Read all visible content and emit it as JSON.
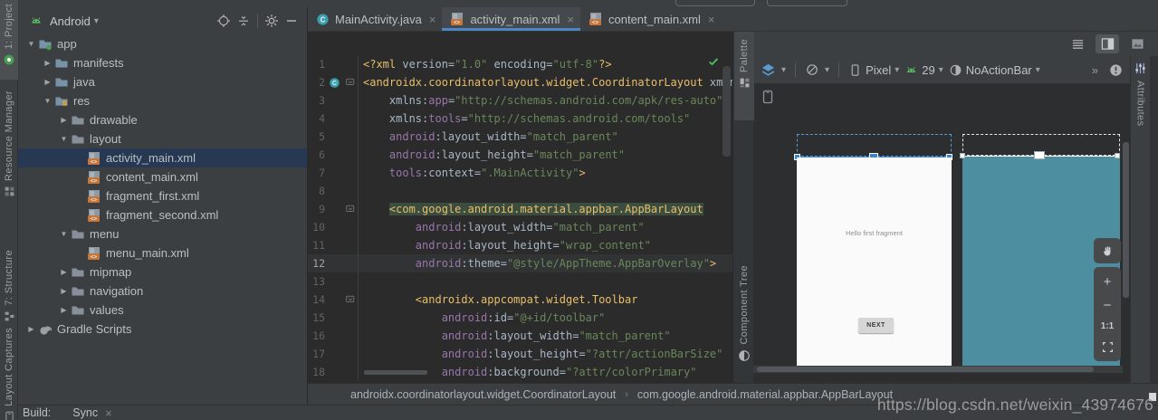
{
  "left_strip": {
    "items": [
      {
        "label": "1: Project"
      },
      {
        "label": "Resource Manager"
      },
      {
        "label": "7: Structure"
      },
      {
        "label": "Layout Captures"
      }
    ]
  },
  "project_panel": {
    "header": {
      "title": "Android"
    },
    "tree": [
      {
        "label": "app",
        "depth": 0,
        "arrow": "expanded",
        "icon": "folder-app"
      },
      {
        "label": "manifests",
        "depth": 1,
        "arrow": "collapsed",
        "icon": "folder"
      },
      {
        "label": "java",
        "depth": 1,
        "arrow": "collapsed",
        "icon": "folder"
      },
      {
        "label": "res",
        "depth": 1,
        "arrow": "expanded",
        "icon": "folder-res"
      },
      {
        "label": "drawable",
        "depth": 2,
        "arrow": "collapsed",
        "icon": "folder2"
      },
      {
        "label": "layout",
        "depth": 2,
        "arrow": "expanded",
        "icon": "folder2"
      },
      {
        "label": "activity_main.xml",
        "depth": 3,
        "arrow": "none",
        "icon": "xml",
        "selected": true
      },
      {
        "label": "content_main.xml",
        "depth": 3,
        "arrow": "none",
        "icon": "xml"
      },
      {
        "label": "fragment_first.xml",
        "depth": 3,
        "arrow": "none",
        "icon": "xml"
      },
      {
        "label": "fragment_second.xml",
        "depth": 3,
        "arrow": "none",
        "icon": "xml"
      },
      {
        "label": "menu",
        "depth": 2,
        "arrow": "expanded",
        "icon": "folder2"
      },
      {
        "label": "menu_main.xml",
        "depth": 3,
        "arrow": "none",
        "icon": "xml"
      },
      {
        "label": "mipmap",
        "depth": 2,
        "arrow": "collapsed",
        "icon": "folder2"
      },
      {
        "label": "navigation",
        "depth": 2,
        "arrow": "collapsed",
        "icon": "folder2"
      },
      {
        "label": "values",
        "depth": 2,
        "arrow": "collapsed",
        "icon": "folder2"
      },
      {
        "label": "Gradle Scripts",
        "depth": 0,
        "arrow": "collapsed",
        "icon": "gradle"
      }
    ]
  },
  "editor_tabs": [
    {
      "label": "MainActivity.java",
      "icon": "class",
      "active": false
    },
    {
      "label": "activity_main.xml",
      "icon": "xml",
      "active": true
    },
    {
      "label": "content_main.xml",
      "icon": "xml",
      "active": false
    }
  ],
  "editor": {
    "lines": [
      {
        "n": 1,
        "t": [
          [
            "tag",
            "<?xml "
          ],
          [
            "p",
            "version="
          ],
          [
            "str",
            "\"1.0\""
          ],
          [
            "p",
            " encoding="
          ],
          [
            "str",
            "\"utf-8\""
          ],
          [
            "tag",
            "?>"
          ]
        ]
      },
      {
        "n": 2,
        "icon": "class-gutter",
        "fold": true,
        "t": [
          [
            "tag",
            "<androidx.coordinatorlayout.widget.CoordinatorLayout"
          ],
          [
            "p",
            " xmlns"
          ]
        ]
      },
      {
        "n": 3,
        "t": [
          [
            "p",
            "    xmlns:"
          ],
          [
            "ns",
            "app"
          ],
          [
            "p",
            "="
          ],
          [
            "str",
            "\"http://schemas.android.com/apk/res-auto\""
          ]
        ]
      },
      {
        "n": 4,
        "t": [
          [
            "p",
            "    xmlns:"
          ],
          [
            "ns",
            "tools"
          ],
          [
            "p",
            "="
          ],
          [
            "str",
            "\"http://schemas.android.com/tools\""
          ]
        ]
      },
      {
        "n": 5,
        "t": [
          [
            "p",
            "    "
          ],
          [
            "ns",
            "android"
          ],
          [
            "p",
            ":layout_width="
          ],
          [
            "str",
            "\"match_parent\""
          ]
        ]
      },
      {
        "n": 6,
        "t": [
          [
            "p",
            "    "
          ],
          [
            "ns",
            "android"
          ],
          [
            "p",
            ":layout_height="
          ],
          [
            "str",
            "\"match_parent\""
          ]
        ]
      },
      {
        "n": 7,
        "t": [
          [
            "p",
            "    "
          ],
          [
            "ns",
            "tools"
          ],
          [
            "p",
            ":context="
          ],
          [
            "str",
            "\".MainActivity\""
          ],
          [
            "tag",
            ">"
          ]
        ]
      },
      {
        "n": 8,
        "t": []
      },
      {
        "n": 9,
        "fold": true,
        "t": [
          [
            "p",
            "    "
          ],
          [
            "hl",
            "<com.google.android.material.appbar.AppBarLayout"
          ]
        ]
      },
      {
        "n": 10,
        "t": [
          [
            "p",
            "        "
          ],
          [
            "ns",
            "android"
          ],
          [
            "p",
            ":layout_width="
          ],
          [
            "str",
            "\"match_parent\""
          ]
        ]
      },
      {
        "n": 11,
        "t": [
          [
            "p",
            "        "
          ],
          [
            "ns",
            "android"
          ],
          [
            "p",
            ":layout_height="
          ],
          [
            "str",
            "\"wrap_content\""
          ]
        ]
      },
      {
        "n": 12,
        "caret": true,
        "t": [
          [
            "p",
            "        "
          ],
          [
            "ns",
            "android"
          ],
          [
            "p",
            ":theme="
          ],
          [
            "str",
            "\"@style/AppTheme.AppBarOverlay\""
          ],
          [
            "tag",
            ">"
          ]
        ]
      },
      {
        "n": 13,
        "t": []
      },
      {
        "n": 14,
        "fold": true,
        "t": [
          [
            "p",
            "        "
          ],
          [
            "tag",
            "<androidx.appcompat.widget.Toolbar"
          ]
        ]
      },
      {
        "n": 15,
        "t": [
          [
            "p",
            "            "
          ],
          [
            "ns",
            "android"
          ],
          [
            "p",
            ":id="
          ],
          [
            "str",
            "\"@+id/toolbar\""
          ]
        ]
      },
      {
        "n": 16,
        "t": [
          [
            "p",
            "            "
          ],
          [
            "ns",
            "android"
          ],
          [
            "p",
            ":layout_width="
          ],
          [
            "str",
            "\"match_parent\""
          ]
        ]
      },
      {
        "n": 17,
        "t": [
          [
            "p",
            "            "
          ],
          [
            "ns",
            "android"
          ],
          [
            "p",
            ":layout_height="
          ],
          [
            "str",
            "\"?attr/actionBarSize\""
          ]
        ]
      },
      {
        "n": 18,
        "t": [
          [
            "p",
            "            "
          ],
          [
            "ns",
            "android"
          ],
          [
            "p",
            ":background="
          ],
          [
            "str",
            "\"?attr/colorPrimary\""
          ]
        ]
      }
    ],
    "breadcrumbs": {
      "items": [
        "androidx.coordinatorlayout.widget.CoordinatorLayout",
        "com.google.android.material.appbar.AppBarLayout"
      ]
    }
  },
  "design": {
    "toolbar": {
      "device": "Pixel",
      "api": "29",
      "theme": "NoActionBar"
    },
    "view_toggles": [
      {
        "id": "code-view",
        "active": false
      },
      {
        "id": "split-view",
        "active": true
      },
      {
        "id": "design-view",
        "active": false
      }
    ],
    "side_tabs": {
      "palette": "Palette",
      "component_tree": "Component Tree",
      "attributes": "Attributes"
    },
    "canvas": {
      "hello_text": "Hello first fragment",
      "next_button": "NEXT",
      "zoom_ratio": "1:1"
    }
  },
  "status_bar": {
    "build_label": "Build:",
    "build_tab": "Sync"
  },
  "watermark": "https://blog.csdn.net/weixin_43974676",
  "ui_glyphs": {
    "close": "×",
    "chevron": "▾",
    "arrow_collapsed": "▶",
    "arrow_expanded": "▼",
    "overflow": "»",
    "breadcrumb_separator": "›",
    "zoom_in": "+",
    "zoom_out": "−"
  },
  "colors": {
    "accent": "#4A88C7",
    "selection": "#263852",
    "blueprint": "#4D8FA0",
    "xml_tag": "#E8BF6A",
    "xml_namespace": "#9876AA",
    "xml_string": "#6A8759",
    "editor_bg": "#2B2B2B",
    "panel_bg": "#3C3F41"
  }
}
